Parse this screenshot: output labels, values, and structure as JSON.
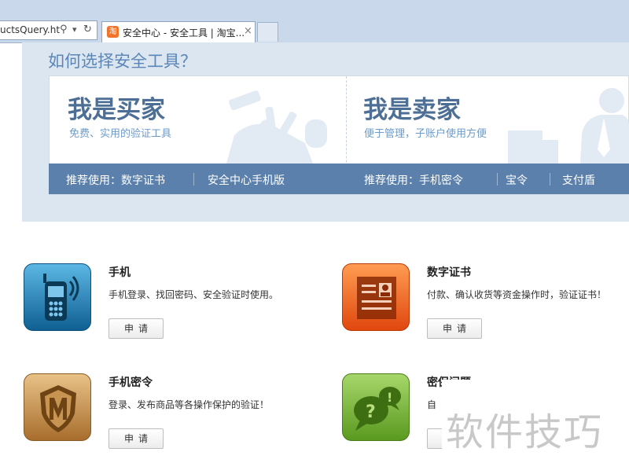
{
  "browser": {
    "address_text": "uctsQuery.ht",
    "tab_icon_label": "淘",
    "tab_title": "安全中心 - 安全工具 | 淘宝...",
    "tab_close": "×",
    "search_glyph": "⚲",
    "dropdown_glyph": "▾",
    "refresh_glyph": "↻"
  },
  "section": {
    "title": "如何选择安全工具？"
  },
  "buyer": {
    "title": "我是买家",
    "subtitle": "免费、实用的验证工具",
    "recommend_label": "推荐使用：数字证书",
    "recommend_item": "安全中心手机版"
  },
  "seller": {
    "title": "我是卖家",
    "subtitle": "便于管理，子账户使用方便",
    "recommend_label": "推荐使用：手机密令",
    "recommend_items": [
      "宝令",
      "支付盾"
    ]
  },
  "products": [
    {
      "name": "手机",
      "desc": "手机登录、找回密码、安全验证时使用。",
      "button": "申请",
      "icon": "mobile-phone-icon",
      "color": "#1a7fb6"
    },
    {
      "name": "数字证书",
      "desc": "付款、确认收货等资金操作时，验证证书！",
      "button": "申请",
      "icon": "certificate-icon",
      "color": "#f0601b"
    },
    {
      "name": "手机密令",
      "desc": "登录、发布商品等各操作保护的验证！",
      "button": "申请",
      "icon": "shield-icon",
      "color": "#c9934a"
    },
    {
      "name": "密保问题",
      "desc": "自",
      "button": "申请",
      "icon": "question-bubble-icon",
      "color": "#7bb637"
    }
  ],
  "watermark": "软件技巧"
}
